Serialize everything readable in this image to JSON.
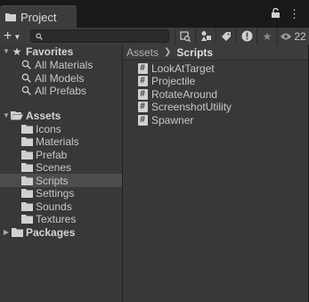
{
  "tab": {
    "title": "Project"
  },
  "toolbar": {
    "create_label": "+",
    "search_value": "",
    "search_placeholder": "",
    "hidden_count": "22"
  },
  "sidebar": {
    "favorites": {
      "label": "Favorites",
      "items": [
        "All Materials",
        "All Models",
        "All Prefabs"
      ]
    },
    "assets": {
      "label": "Assets",
      "items": [
        "Icons",
        "Materials",
        "Prefab",
        "Scenes",
        "Scripts",
        "Settings",
        "Sounds",
        "Textures"
      ],
      "selected": "Scripts"
    },
    "packages": {
      "label": "Packages"
    }
  },
  "breadcrumb": {
    "root": "Assets",
    "current": "Scripts"
  },
  "files": [
    "LookAtTarget",
    "Projectile",
    "RotateAround",
    "ScreenshotUtility",
    "Spawner"
  ],
  "colors": {
    "panel": "#383838",
    "selected": "#4d4d4d",
    "toolbar": "#3c3c3c"
  }
}
